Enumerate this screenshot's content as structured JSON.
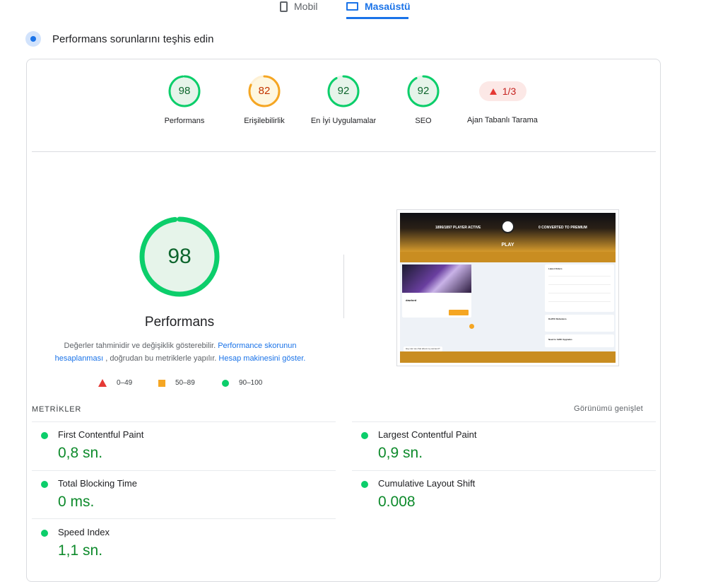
{
  "device_tabs": {
    "mobile_label": "Mobil",
    "desktop_label": "Masaüstü",
    "selected": "desktop"
  },
  "diagnose": {
    "title": "Performans sorunlarını teşhis edin"
  },
  "scores": [
    {
      "label": "Performans",
      "value": 98,
      "status": "pass",
      "color": "#0cce6b"
    },
    {
      "label": "Erişilebilirlik",
      "value": 82,
      "status": "average",
      "color": "#f5a623"
    },
    {
      "label": "En İyi Uygulamalar",
      "value": 92,
      "status": "pass",
      "color": "#0cce6b"
    },
    {
      "label": "SEO",
      "value": 92,
      "status": "pass",
      "color": "#0cce6b"
    }
  ],
  "agent_badge": {
    "value": "1/3",
    "label": "Ajan Tabanlı Tarama",
    "color": "#e53935"
  },
  "performance": {
    "score": 98,
    "title": "Performans",
    "desc_prefix": "Değerler tahminidir ve değişiklik gösterebilir.",
    "desc_link1": "Performance skorunun hesaplanması",
    "desc_mid": ", doğrudan bu metriklerle yapılır.",
    "desc_link2": "Hesap makinesini göster.",
    "legend": [
      {
        "range": "0–49",
        "shape": "triangle",
        "color": "#e53935"
      },
      {
        "range": "50–89",
        "shape": "square",
        "color": "#f5a623"
      },
      {
        "range": "90–100",
        "shape": "circle",
        "color": "#0cce6b"
      }
    ]
  },
  "screenshot": {
    "head_left": "1896/1897 PLAYER ACTIVE",
    "head_right": "0 CONVERTED TO PREMIUM",
    "play": "PLAY",
    "card_title": "dawlord",
    "side_title": "Latest Orders",
    "side2_title": "DotPlU Refunders",
    "side3_title": "Need to fulfill Upgrades",
    "chat": "Hey can we chat about my account?"
  },
  "metrics": {
    "heading": "METRİKLER",
    "expand": "Görünümü genişlet",
    "items": [
      {
        "label": "First Contentful Paint",
        "value": "0,8 sn."
      },
      {
        "label": "Largest Contentful Paint",
        "value": "0,9 sn."
      },
      {
        "label": "Total Blocking Time",
        "value": "0 ms."
      },
      {
        "label": "Cumulative Layout Shift",
        "value": "0.008"
      },
      {
        "label": "Speed Index",
        "value": "1,1 sn."
      }
    ]
  },
  "colors": {
    "accent": "#1a73e8",
    "pass": "#0cce6b",
    "average": "#f5a623",
    "fail": "#e53935"
  }
}
